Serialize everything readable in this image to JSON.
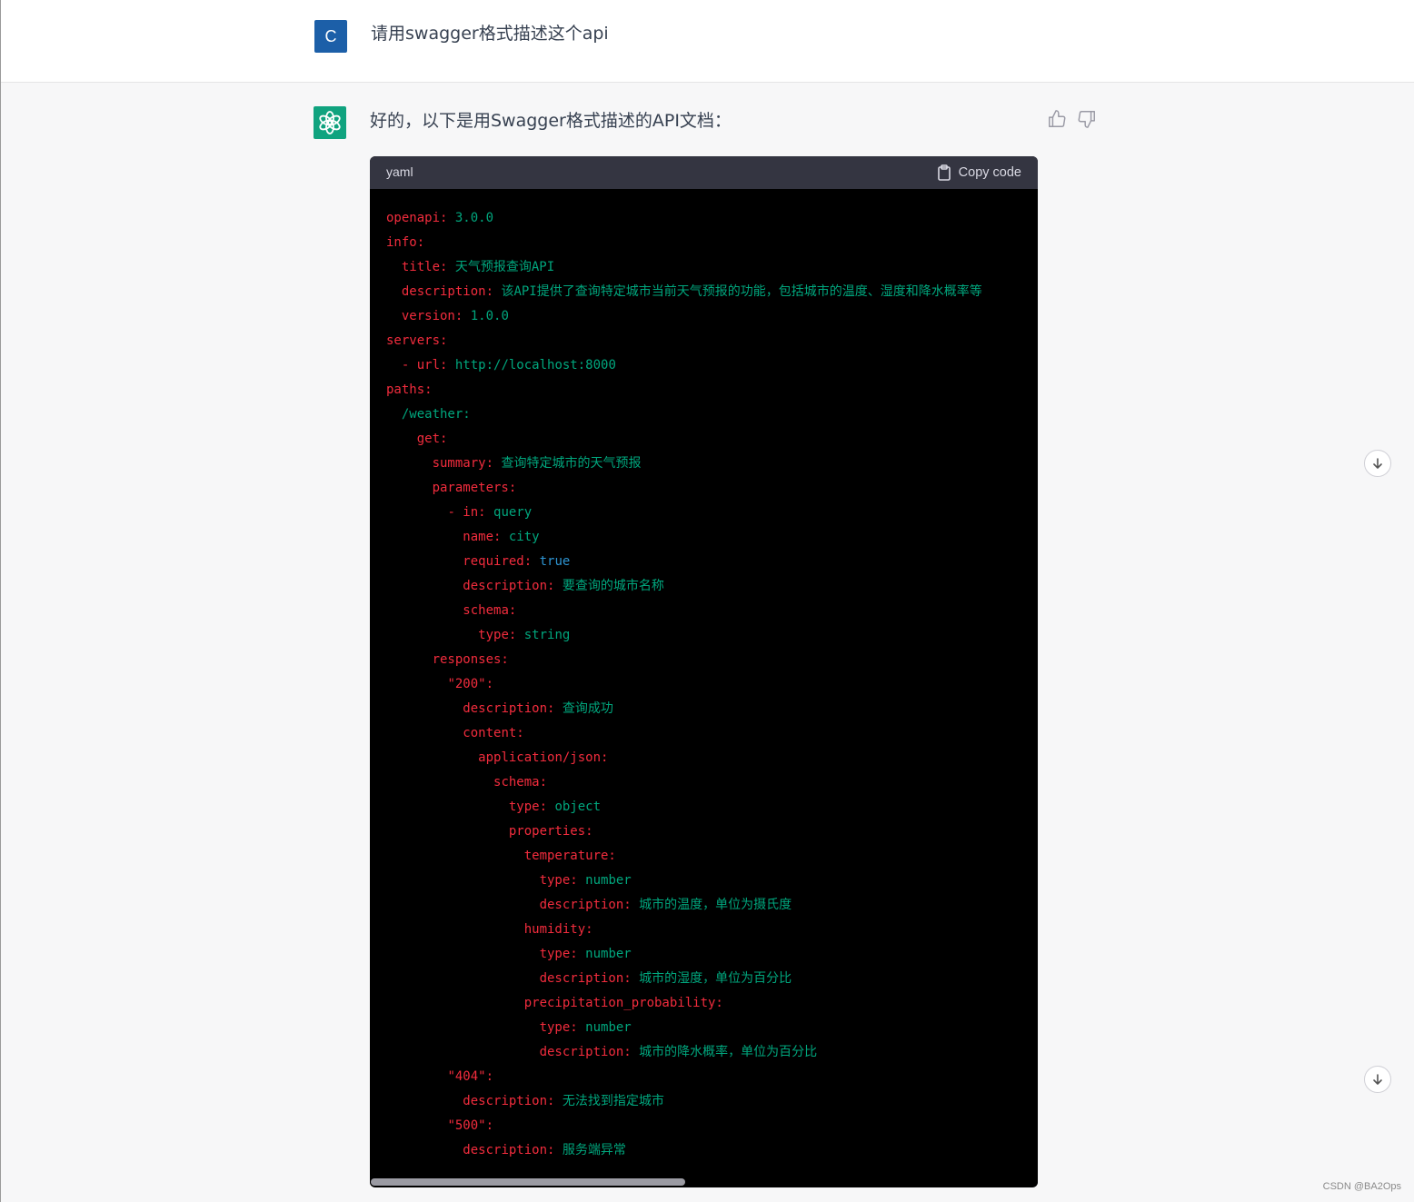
{
  "user_message": {
    "avatar_letter": "C",
    "text": "请用swagger格式描述这个api"
  },
  "assistant_message": {
    "intro": "好的，以下是用Swagger格式描述的API文档：",
    "code_language": "yaml",
    "copy_label": "Copy code",
    "code_lines": [
      {
        "indent": "",
        "key": "openapi:",
        "val": " 3.0.0",
        "vclass": "v"
      },
      {
        "indent": "",
        "key": "info:",
        "val": "",
        "vclass": "v"
      },
      {
        "indent": "  ",
        "key": "title:",
        "val": " 天气预报查询API",
        "vclass": "v"
      },
      {
        "indent": "  ",
        "key": "description:",
        "val": " 该API提供了查询特定城市当前天气预报的功能，包括城市的温度、湿度和降水概率等",
        "vclass": "v"
      },
      {
        "indent": "  ",
        "key": "version:",
        "val": " 1.0.0",
        "vclass": "v"
      },
      {
        "indent": "",
        "key": "servers:",
        "val": "",
        "vclass": "v"
      },
      {
        "indent": "  ",
        "key": "- url:",
        "val": " http://localhost:8000",
        "vclass": "v"
      },
      {
        "indent": "",
        "key": "paths:",
        "val": "",
        "vclass": "v"
      },
      {
        "indent": "  ",
        "key": "",
        "val": "/weather:",
        "vclass": "v"
      },
      {
        "indent": "    ",
        "key": "get:",
        "val": "",
        "vclass": "v"
      },
      {
        "indent": "      ",
        "key": "summary:",
        "val": " 查询特定城市的天气预报",
        "vclass": "v"
      },
      {
        "indent": "      ",
        "key": "parameters:",
        "val": "",
        "vclass": "v"
      },
      {
        "indent": "        ",
        "key": "- in:",
        "val": " query",
        "vclass": "v"
      },
      {
        "indent": "          ",
        "key": "name:",
        "val": " city",
        "vclass": "v"
      },
      {
        "indent": "          ",
        "key": "required:",
        "val": " true",
        "vclass": "b"
      },
      {
        "indent": "          ",
        "key": "description:",
        "val": " 要查询的城市名称",
        "vclass": "v"
      },
      {
        "indent": "          ",
        "key": "schema:",
        "val": "",
        "vclass": "v"
      },
      {
        "indent": "            ",
        "key": "type:",
        "val": " string",
        "vclass": "v"
      },
      {
        "indent": "      ",
        "key": "responses:",
        "val": "",
        "vclass": "v"
      },
      {
        "indent": "        ",
        "key": "\"200\":",
        "val": "",
        "vclass": "v"
      },
      {
        "indent": "          ",
        "key": "description:",
        "val": " 查询成功",
        "vclass": "v"
      },
      {
        "indent": "          ",
        "key": "content:",
        "val": "",
        "vclass": "v"
      },
      {
        "indent": "            ",
        "key": "application/json:",
        "val": "",
        "vclass": "v"
      },
      {
        "indent": "              ",
        "key": "schema:",
        "val": "",
        "vclass": "v"
      },
      {
        "indent": "                ",
        "key": "type:",
        "val": " object",
        "vclass": "v"
      },
      {
        "indent": "                ",
        "key": "properties:",
        "val": "",
        "vclass": "v"
      },
      {
        "indent": "                  ",
        "key": "temperature:",
        "val": "",
        "vclass": "v"
      },
      {
        "indent": "                    ",
        "key": "type:",
        "val": " number",
        "vclass": "v"
      },
      {
        "indent": "                    ",
        "key": "description:",
        "val": " 城市的温度，单位为摄氏度",
        "vclass": "v"
      },
      {
        "indent": "                  ",
        "key": "humidity:",
        "val": "",
        "vclass": "v"
      },
      {
        "indent": "                    ",
        "key": "type:",
        "val": " number",
        "vclass": "v"
      },
      {
        "indent": "                    ",
        "key": "description:",
        "val": " 城市的湿度，单位为百分比",
        "vclass": "v"
      },
      {
        "indent": "                  ",
        "key": "precipitation_probability:",
        "val": "",
        "vclass": "v"
      },
      {
        "indent": "                    ",
        "key": "type:",
        "val": " number",
        "vclass": "v"
      },
      {
        "indent": "                    ",
        "key": "description:",
        "val": " 城市的降水概率，单位为百分比",
        "vclass": "v"
      },
      {
        "indent": "        ",
        "key": "\"404\":",
        "val": "",
        "vclass": "v"
      },
      {
        "indent": "          ",
        "key": "description:",
        "val": " 无法找到指定城市",
        "vclass": "v"
      },
      {
        "indent": "        ",
        "key": "\"500\":",
        "val": "",
        "vclass": "v"
      },
      {
        "indent": "          ",
        "key": "description:",
        "val": " 服务端异常",
        "vclass": "v"
      }
    ]
  },
  "watermark": "CSDN @BA2Ops",
  "colors": {
    "key": "#f22c3d",
    "value": "#00a67d",
    "boolean": "#2e95d3",
    "code_bg": "#000000",
    "header_bg": "#343541",
    "assistant_avatar": "#10a37f",
    "user_avatar": "#1c5fa8"
  },
  "icons": {
    "thumbs_up": "thumbs-up-icon",
    "thumbs_down": "thumbs-down-icon",
    "copy": "clipboard-icon",
    "scroll_down": "arrow-down-icon",
    "assistant": "openai-logo-icon"
  }
}
